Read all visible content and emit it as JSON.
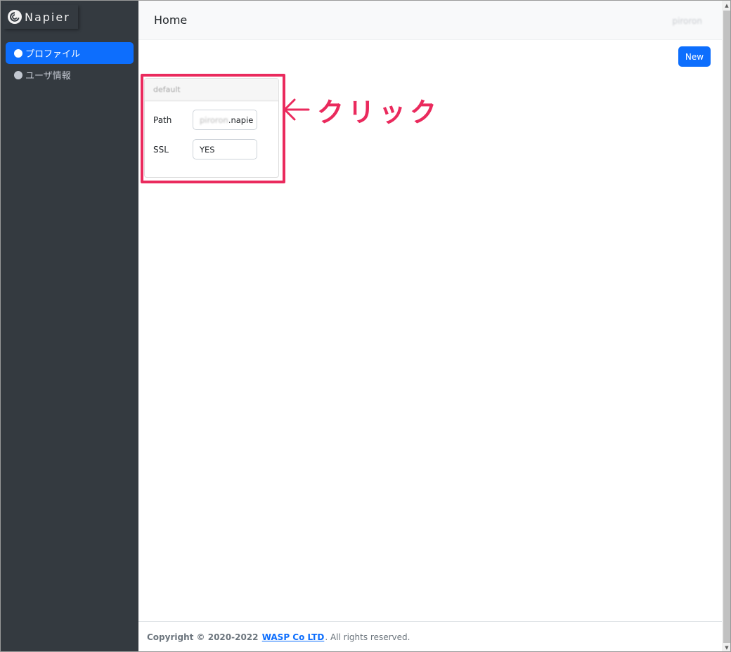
{
  "sidebar": {
    "brand": "Napier",
    "items": [
      {
        "label": "プロファイル",
        "active": true
      },
      {
        "label": "ユーザ情報",
        "active": false
      }
    ]
  },
  "header": {
    "title": "Home",
    "user": "piroron"
  },
  "toolbar": {
    "new_label": "New"
  },
  "card": {
    "title": "default",
    "rows": [
      {
        "label": "Path",
        "value_blurred": "piroron",
        "value": ".napie"
      },
      {
        "label": "SSL",
        "value": "YES"
      }
    ]
  },
  "annotation": {
    "text": "クリック",
    "color": "#ea2a5d"
  },
  "footer": {
    "prefix": "Copyright © 2020-2022 ",
    "company": "WASP Co LTD",
    "suffix": ". All rights reserved."
  },
  "colors": {
    "primary": "#0d6efd",
    "sidebar_bg": "#343a40"
  },
  "icons": {
    "brand": "napier-swirl-logo-icon",
    "nav_item": "circle-icon",
    "annotation": "arrow-left-icon"
  }
}
